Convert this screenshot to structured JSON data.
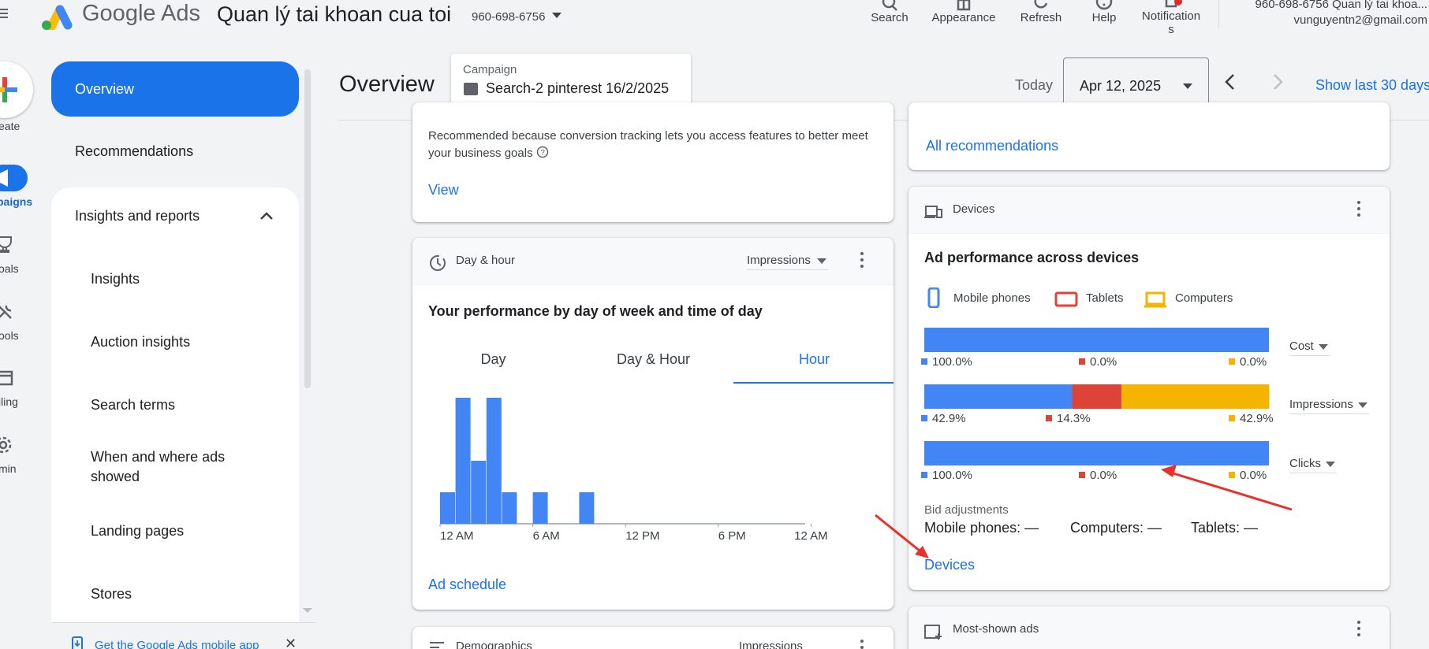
{
  "topbar": {
    "brand": "Google Ads",
    "account_name": "Quan lý tai khoan cua toi",
    "account_id": "960-698-6756",
    "tools": [
      {
        "label": "Search",
        "icon": "search-icon"
      },
      {
        "label": "Appearance",
        "icon": "appearance-icon"
      },
      {
        "label": "Refresh",
        "icon": "refresh-icon"
      },
      {
        "label": "Help",
        "icon": "help-icon"
      },
      {
        "label": "Notification\ns",
        "icon": "bell-icon"
      }
    ],
    "account_line1": "960-698-6756 Quan lý tai khoa...",
    "account_line2": "vunguyentn2@gmail.com"
  },
  "rail": {
    "create": "eate",
    "campaigns": "paigns",
    "goals": "oals",
    "tools": "ools",
    "billing": "iling",
    "admin": "min"
  },
  "nav": {
    "overview": "Overview",
    "recommendations": "Recommendations",
    "group_title": "Insights and reports",
    "sub_items": [
      "Insights",
      "Auction insights",
      "Search terms",
      "When and where ads showed",
      "Landing pages",
      "Stores"
    ],
    "mobile_app": "Get the Google Ads mobile app",
    "mobile_close": "✕"
  },
  "header": {
    "title": "Overview",
    "campaign_label": "Campaign",
    "campaign_value": "Search-2 pinterest 16/2/2025",
    "today_label": "Today",
    "date_value": "Apr 12, 2025",
    "show_last": "Show last 30 days"
  },
  "rec_card": {
    "text": "Recommended because conversion tracking lets you access features to better meet your business goals",
    "view": "View",
    "all_recommendations": "All recommendations"
  },
  "dayhour_card": {
    "title": "Day & hour",
    "metric": "Impressions",
    "heading": "Your performance by day of week and time of day",
    "tabs": [
      "Day",
      "Day & Hour",
      "Hour"
    ],
    "active_tab": "Hour",
    "link": "Ad schedule"
  },
  "devices_card": {
    "title": "Devices",
    "heading": "Ad performance across devices",
    "legend": [
      "Mobile phones",
      "Tablets",
      "Computers"
    ],
    "colors": {
      "mobile": "#4285f4",
      "tablets": "#db4437",
      "computers": "#f4b400"
    },
    "bid_label": "Bid adjustments",
    "bid_mobile": "Mobile phones: —",
    "bid_computers": "Computers: —",
    "bid_tablets": "Tablets: —",
    "link": "Devices"
  },
  "most_shown_card": {
    "title": "Most-shown ads"
  },
  "demographics_card": {
    "title": "Demographics",
    "metric": "Impressions"
  },
  "chart_data": [
    {
      "type": "bar",
      "title": "Your performance by day of week and time of day",
      "metric": "Impressions",
      "categories": [
        "0",
        "1",
        "2",
        "3",
        "4",
        "5",
        "6",
        "7",
        "8",
        "9",
        "10",
        "11",
        "12",
        "13",
        "14",
        "15",
        "16",
        "17",
        "18",
        "19",
        "20",
        "21",
        "22",
        "23"
      ],
      "values": [
        1,
        4,
        2,
        4,
        1,
        0,
        1,
        0,
        0,
        1,
        0,
        0,
        0,
        0,
        0,
        0,
        0,
        0,
        0,
        0,
        0,
        0,
        0,
        0
      ],
      "x_tick_labels": [
        "12 AM",
        "6 AM",
        "12 PM",
        "6 PM",
        "12 AM"
      ],
      "grid": false
    },
    {
      "type": "bar",
      "stacked": true,
      "orientation": "horizontal",
      "categories": [
        "Cost",
        "Impressions",
        "Clicks"
      ],
      "series": [
        {
          "name": "Mobile phones",
          "values": [
            100.0,
            42.9,
            100.0
          ]
        },
        {
          "name": "Tablets",
          "values": [
            0.0,
            14.3,
            0.0
          ]
        },
        {
          "name": "Computers",
          "values": [
            0.0,
            42.9,
            0.0
          ]
        }
      ],
      "value_labels": [
        [
          "100.0%",
          "0.0%",
          "0.0%"
        ],
        [
          "42.9%",
          "14.3%",
          "42.9%"
        ],
        [
          "100.0%",
          "0.0%",
          "0.0%"
        ]
      ],
      "unit": "%",
      "legend": "top"
    }
  ]
}
